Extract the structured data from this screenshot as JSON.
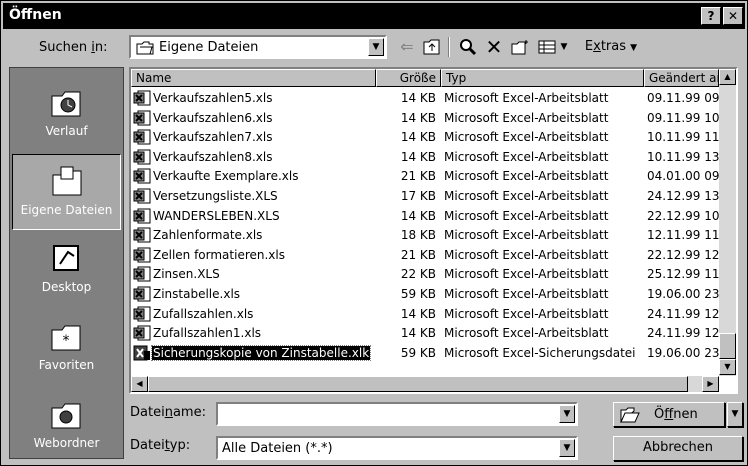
{
  "title": "Öffnen",
  "title_buttons": {
    "help": "?",
    "close": "✕"
  },
  "look_in": {
    "label_pre": "Suchen ",
    "label_u": "i",
    "label_post": "n:",
    "value": "Eigene Dateien"
  },
  "toolbar": {
    "extras_pre": "E",
    "extras_u": "x",
    "extras_post": "tras"
  },
  "places": [
    {
      "label": "Verlauf",
      "icon": "history-icon"
    },
    {
      "label": "Eigene Dateien",
      "icon": "my-documents-icon"
    },
    {
      "label": "Desktop",
      "icon": "desktop-icon"
    },
    {
      "label": "Favoriten",
      "icon": "favorites-icon"
    },
    {
      "label": "Webordner",
      "icon": "web-folders-icon"
    }
  ],
  "columns": {
    "name": "Name",
    "size": "Größe",
    "type": "Typ",
    "modified": "Geändert am"
  },
  "files": [
    {
      "name": "Verkaufszahlen5.xls",
      "size": "14 KB",
      "type": "Microsoft Excel-Arbeitsblatt",
      "modified": "09.11.99 09"
    },
    {
      "name": "Verkaufszahlen6.xls",
      "size": "14 KB",
      "type": "Microsoft Excel-Arbeitsblatt",
      "modified": "09.11.99 10"
    },
    {
      "name": "Verkaufszahlen7.xls",
      "size": "14 KB",
      "type": "Microsoft Excel-Arbeitsblatt",
      "modified": "10.11.99 11"
    },
    {
      "name": "Verkaufszahlen8.xls",
      "size": "14 KB",
      "type": "Microsoft Excel-Arbeitsblatt",
      "modified": "10.11.99 13"
    },
    {
      "name": "Verkaufte Exemplare.xls",
      "size": "21 KB",
      "type": "Microsoft Excel-Arbeitsblatt",
      "modified": "04.01.00 09"
    },
    {
      "name": "Versetzungsliste.XLS",
      "size": "17 KB",
      "type": "Microsoft Excel-Arbeitsblatt",
      "modified": "24.12.99 13"
    },
    {
      "name": "WANDERSLEBEN.XLS",
      "size": "14 KB",
      "type": "Microsoft Excel-Arbeitsblatt",
      "modified": "22.12.99 10"
    },
    {
      "name": "Zahlenformate.xls",
      "size": "18 KB",
      "type": "Microsoft Excel-Arbeitsblatt",
      "modified": "12.11.99 11"
    },
    {
      "name": "Zellen formatieren.xls",
      "size": "21 KB",
      "type": "Microsoft Excel-Arbeitsblatt",
      "modified": "22.12.99 12"
    },
    {
      "name": "Zinsen.XLS",
      "size": "22 KB",
      "type": "Microsoft Excel-Arbeitsblatt",
      "modified": "25.12.99 11"
    },
    {
      "name": "Zinstabelle.xls",
      "size": "59 KB",
      "type": "Microsoft Excel-Arbeitsblatt",
      "modified": "19.06.00 23"
    },
    {
      "name": "Zufallszahlen.xls",
      "size": "14 KB",
      "type": "Microsoft Excel-Arbeitsblatt",
      "modified": "24.11.99 12"
    },
    {
      "name": "Zufallszahlen1.xls",
      "size": "14 KB",
      "type": "Microsoft Excel-Arbeitsblatt",
      "modified": "24.11.99 12"
    },
    {
      "name": "Sicherungskopie von Zinstabelle.xlk",
      "size": "59 KB",
      "type": "Microsoft Excel-Sicherungsdatei",
      "modified": "19.06.00 23",
      "selected": true
    }
  ],
  "filename": {
    "label_pre": "Datei",
    "label_u": "n",
    "label_post": "ame:",
    "value": ""
  },
  "filetype": {
    "label_pre": "Datei",
    "label_u": "t",
    "label_post": "yp:",
    "value": "Alle Dateien (*.*)"
  },
  "buttons": {
    "open_pre": "Ö",
    "open_u": "f",
    "open_post": "fnen",
    "cancel": "Abbrechen"
  },
  "colors": {
    "title_bg": "#000000",
    "face": "#c0c0c0",
    "places_bg": "#808080"
  }
}
